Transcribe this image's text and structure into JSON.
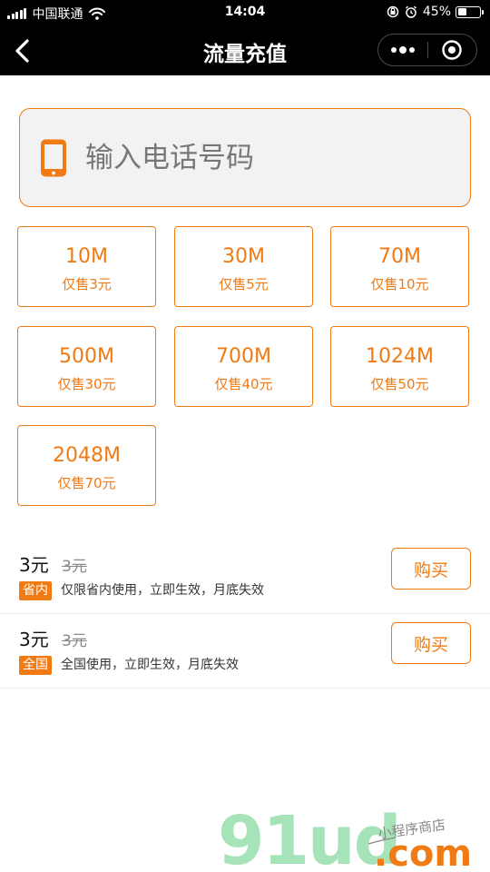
{
  "status_bar": {
    "carrier": "中国联通",
    "time": "14:04",
    "battery_pct": "45%",
    "battery_level": 0.45,
    "icons": [
      "signal-icon",
      "wifi-icon",
      "rotation-lock-icon",
      "alarm-icon",
      "battery-icon"
    ]
  },
  "nav": {
    "title": "流量充值",
    "icons": [
      "back-arrow-icon",
      "more-dots-icon",
      "target-close-icon"
    ]
  },
  "phone": {
    "placeholder": "输入电话号码",
    "value": "",
    "icon": "mobile-phone-icon"
  },
  "packages": [
    {
      "size": "10M",
      "price": "仅售3元"
    },
    {
      "size": "30M",
      "price": "仅售5元"
    },
    {
      "size": "70M",
      "price": "仅售10元"
    },
    {
      "size": "500M",
      "price": "仅售30元"
    },
    {
      "size": "700M",
      "price": "仅售40元"
    },
    {
      "size": "1024M",
      "price": "仅售50元"
    },
    {
      "size": "2048M",
      "price": "仅售70元"
    }
  ],
  "offers": [
    {
      "price": "3元",
      "original": "3元",
      "badge": "省内",
      "desc": "仅限省内使用，立即生效，月底失效",
      "buy": "购买"
    },
    {
      "price": "3元",
      "original": "3元",
      "badge": "全国",
      "desc": "全国使用，立即生效，月底失效",
      "buy": "购买"
    }
  ],
  "watermark": {
    "logo": "91ud",
    "domain": ".com",
    "tagline": "小程序商店"
  },
  "colors": {
    "accent": "#f07a14",
    "bar": "#000000",
    "input_bg": "#f2f2f2",
    "watermark_green": "#a6e3b8"
  }
}
